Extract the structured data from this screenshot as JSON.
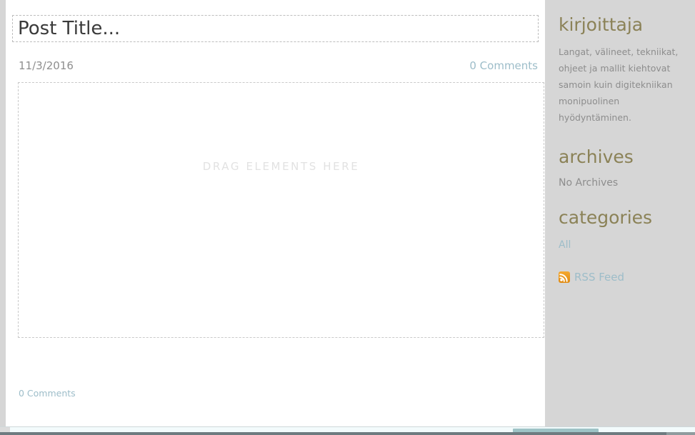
{
  "post": {
    "title": "Post Title...",
    "date": "11/3/2016",
    "comments_top": "0 Comments",
    "comments_bottom": "0 Comments",
    "drag_placeholder": "DRAG ELEMENTS HERE"
  },
  "sidebar": {
    "author": {
      "heading": "kirjoittaja",
      "bio": "Langat, välineet, tekniikat, ohjeet ja mallit kiehtovat samoin kuin digitekniikan monipuolinen hyödyntäminen."
    },
    "archives": {
      "heading": "archives",
      "empty_text": "No Archives"
    },
    "categories": {
      "heading": "categories",
      "items": [
        "All"
      ]
    },
    "rss": {
      "label": "RSS Feed",
      "icon": "rss-icon"
    }
  },
  "colors": {
    "page_background": "#d6d6d6",
    "content_background": "#ffffff",
    "heading_accent": "#8b8257",
    "link": "#9dbdc9",
    "muted_text": "#8d8d8d",
    "title_text": "#3a3a3a",
    "placeholder_text": "#e2e2e2",
    "rss_orange": "#f5a830"
  }
}
